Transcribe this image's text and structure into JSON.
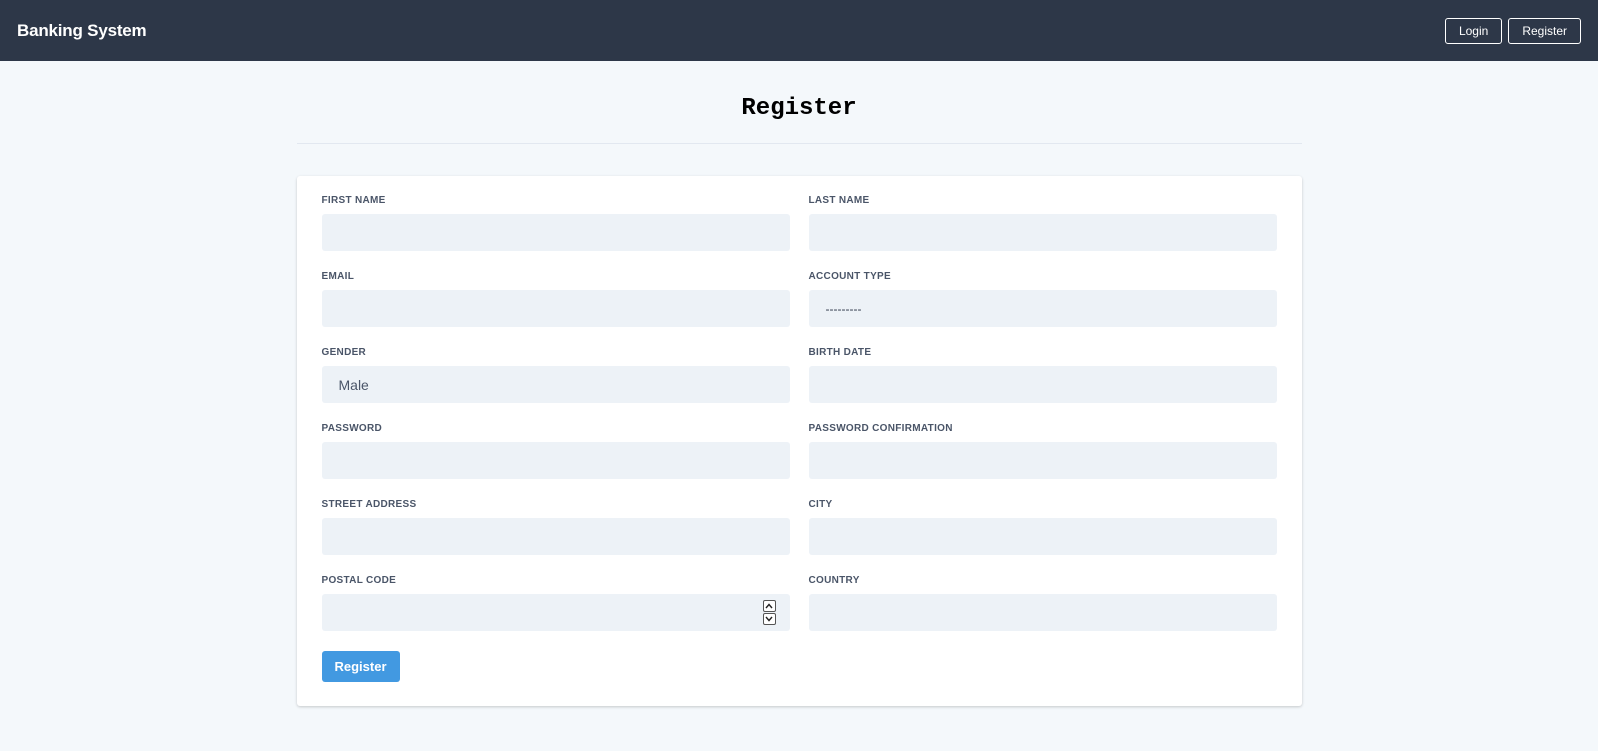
{
  "navbar": {
    "brand": "Banking System",
    "login_label": "Login",
    "register_label": "Register"
  },
  "page": {
    "title": "Register"
  },
  "form": {
    "first_name": {
      "label": "FIRST NAME",
      "value": ""
    },
    "last_name": {
      "label": "LAST NAME",
      "value": ""
    },
    "email": {
      "label": "EMAIL",
      "value": ""
    },
    "account_type": {
      "label": "ACCOUNT TYPE",
      "value": "---------"
    },
    "gender": {
      "label": "GENDER",
      "value": "Male"
    },
    "birth_date": {
      "label": "BIRTH DATE",
      "value": ""
    },
    "password": {
      "label": "PASSWORD",
      "value": ""
    },
    "password_confirmation": {
      "label": "PASSWORD CONFIRMATION",
      "value": ""
    },
    "street_address": {
      "label": "STREET ADDRESS",
      "value": ""
    },
    "city": {
      "label": "CITY",
      "value": ""
    },
    "postal_code": {
      "label": "POSTAL CODE",
      "value": ""
    },
    "country": {
      "label": "COUNTRY",
      "value": ""
    },
    "submit_label": "Register"
  },
  "colors": {
    "navbar_bg": "#2d3748",
    "page_bg": "#f4f8fb",
    "input_bg": "#edf2f7",
    "accent": "#4299e1"
  },
  "icons": {
    "spinner_up": "chevron-up-icon",
    "spinner_down": "chevron-down-icon"
  }
}
